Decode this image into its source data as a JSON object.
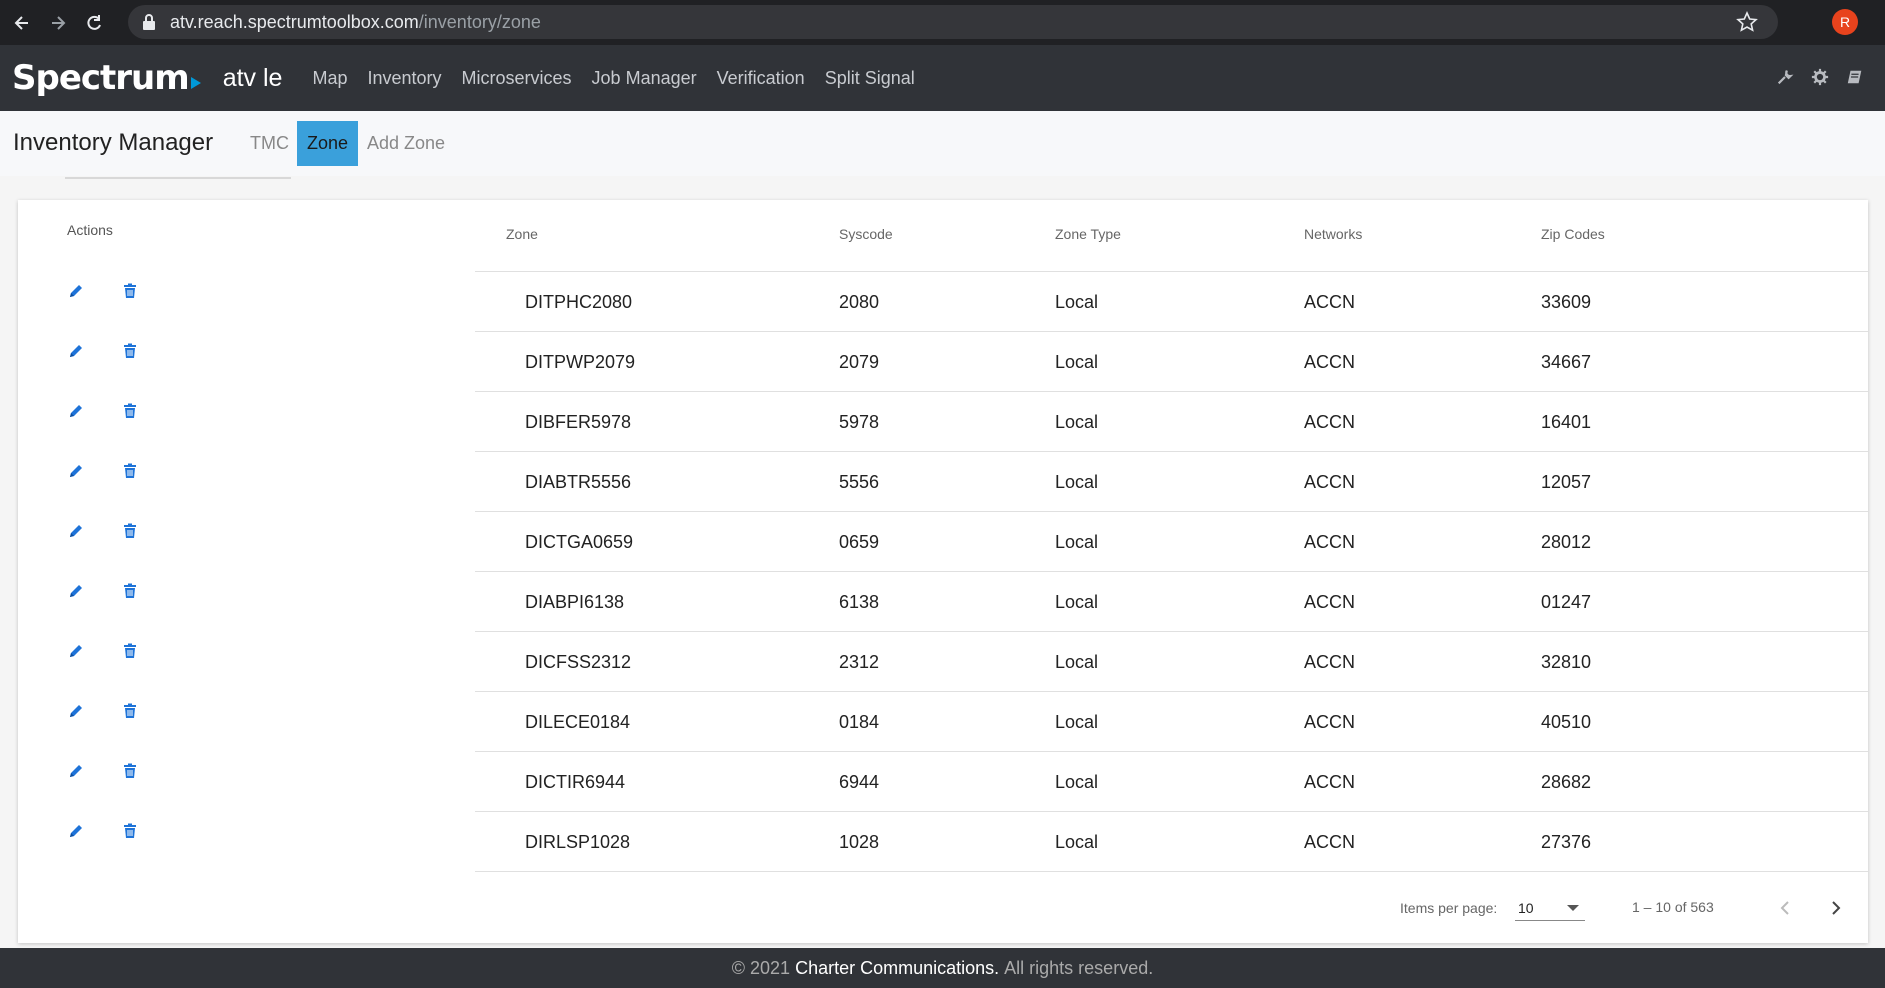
{
  "browser": {
    "url_host": "atv.reach.spectrumtoolbox.com",
    "url_path": "/inventory/zone",
    "profile_initial": "R"
  },
  "header": {
    "logo": "Spectrum",
    "env": "atv le",
    "nav": [
      "Map",
      "Inventory",
      "Microservices",
      "Job Manager",
      "Verification",
      "Split Signal"
    ]
  },
  "subheader": {
    "title": "Inventory Manager",
    "tabs": [
      "TMC",
      "Zone",
      "Add Zone"
    ],
    "active_tab": "Zone"
  },
  "table": {
    "actions_label": "Actions",
    "columns": [
      "Zone",
      "Syscode",
      "Zone Type",
      "Networks",
      "Zip Codes"
    ],
    "rows": [
      {
        "zone": "DITPHC2080",
        "syscode": "2080",
        "type": "Local",
        "networks": "ACCN",
        "zip": "33609"
      },
      {
        "zone": "DITPWP2079",
        "syscode": "2079",
        "type": "Local",
        "networks": "ACCN",
        "zip": "34667"
      },
      {
        "zone": "DIBFER5978",
        "syscode": "5978",
        "type": "Local",
        "networks": "ACCN",
        "zip": "16401"
      },
      {
        "zone": "DIABTR5556",
        "syscode": "5556",
        "type": "Local",
        "networks": "ACCN",
        "zip": "12057"
      },
      {
        "zone": "DICTGA0659",
        "syscode": "0659",
        "type": "Local",
        "networks": "ACCN",
        "zip": "28012"
      },
      {
        "zone": "DIABPI6138",
        "syscode": "6138",
        "type": "Local",
        "networks": "ACCN",
        "zip": "01247"
      },
      {
        "zone": "DICFSS2312",
        "syscode": "2312",
        "type": "Local",
        "networks": "ACCN",
        "zip": "32810"
      },
      {
        "zone": "DILECE0184",
        "syscode": "0184",
        "type": "Local",
        "networks": "ACCN",
        "zip": "40510"
      },
      {
        "zone": "DICTIR6944",
        "syscode": "6944",
        "type": "Local",
        "networks": "ACCN",
        "zip": "28682"
      },
      {
        "zone": "DIRLSP1028",
        "syscode": "1028",
        "type": "Local",
        "networks": "ACCN",
        "zip": "27376"
      }
    ]
  },
  "paginator": {
    "items_per_page_label": "Items per page:",
    "items_per_page": "10",
    "range": "1 – 10 of 563"
  },
  "footer": {
    "copyright": "© 2021",
    "company": "Charter Communications.",
    "rights": "All rights reserved."
  },
  "colors": {
    "accent": "#3aa0db",
    "icon_blue": "#1e73d8",
    "header_bg": "#303338"
  }
}
